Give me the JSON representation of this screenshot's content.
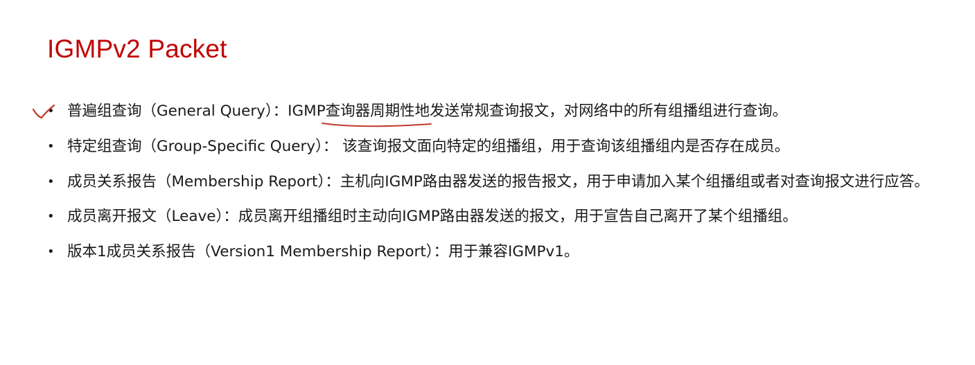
{
  "slide": {
    "title": "IGMPv2 Packet"
  },
  "bullets": [
    {
      "text": "普遍组查询（General Query）：IGMP查询器周期性地发送常规查询报文，对网络中的所有组播组进行查询。"
    },
    {
      "text": "特定组查询（Group-Specific Query）： 该查询报文面向特定的组播组，用于查询该组播组内是否存在成员。"
    },
    {
      "text": "成员关系报告（Membership Report）：主机向IGMP路由器发送的报告报文，用于申请加入某个组播组或者对查询报文进行应答。"
    },
    {
      "text": "成员离开报文（Leave）：成员离开组播组时主动向IGMP路由器发送的报文，用于宣告自己离开了某个组播组。"
    },
    {
      "text": "版本1成员关系报告（Version1 Membership Report）：用于兼容IGMPv1。"
    }
  ],
  "bullet_symbol": "•",
  "annotation_color": "#c0392b"
}
